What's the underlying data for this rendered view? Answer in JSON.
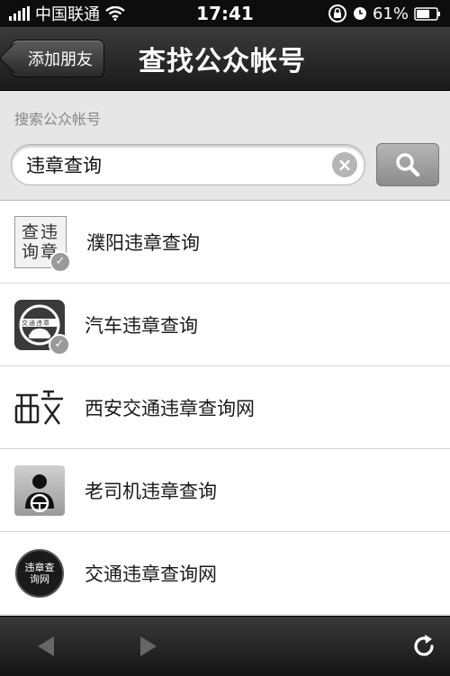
{
  "status": {
    "carrier": "中国联通",
    "time": "17:41",
    "battery": "61%"
  },
  "nav": {
    "back_label": "添加朋友",
    "title": "查找公众帐号"
  },
  "search": {
    "label": "搜索公众帐号",
    "value": "违章查询"
  },
  "results": [
    {
      "name": "濮阳违章查询",
      "icon_text": "查违询章"
    },
    {
      "name": "汽车违章查询",
      "icon_text": "交通违章"
    },
    {
      "name": "西安交通违章查询网",
      "icon_text": ""
    },
    {
      "name": "老司机违章查询",
      "icon_text": ""
    },
    {
      "name": "交通违章查询网",
      "icon_text": "违章查询网"
    }
  ]
}
